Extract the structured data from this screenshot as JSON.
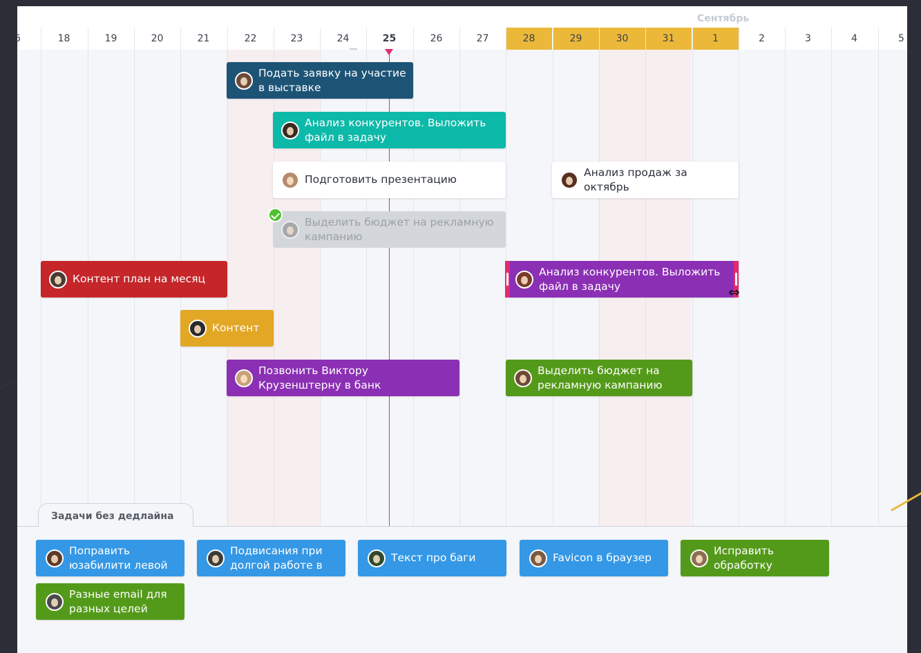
{
  "timeline": {
    "month_label": "Сентябрь",
    "today_day": "25",
    "days": [
      "6",
      "18",
      "19",
      "20",
      "21",
      "22",
      "23",
      "24",
      "25",
      "26",
      "27",
      "28",
      "29",
      "30",
      "31",
      "1",
      "2",
      "3",
      "4",
      "5"
    ]
  },
  "tasks": [
    {
      "name": "task-submit-exhibition",
      "title": "Подать заявку на участие в выставке",
      "color": "#1d5476",
      "style": "normal"
    },
    {
      "name": "task-competitor-analysis-1",
      "title": "Анализ конкурентов. Выложить файл в задачу",
      "color": "#0db9a9",
      "style": "normal"
    },
    {
      "name": "task-prepare-presentation",
      "title": "Подготовить презентацию",
      "color": "#ffffff",
      "style": "white"
    },
    {
      "name": "task-sales-analysis",
      "title": "Анализ продаж за октябрь",
      "color": "#ffffff",
      "style": "white"
    },
    {
      "name": "task-allocate-budget-done",
      "title": "Выделить бюджет на рекламную кампанию",
      "color": "#d3d6da",
      "style": "done"
    },
    {
      "name": "task-content-plan",
      "title": "Контент план на месяц",
      "color": "#c5262a",
      "style": "normal"
    },
    {
      "name": "task-competitor-analysis-2",
      "title": "Анализ конкурентов. Выложить файл в задачу",
      "color": "#8b2fb4",
      "style": "selected"
    },
    {
      "name": "task-content",
      "title": "Контент",
      "color": "#e2a725",
      "style": "normal"
    },
    {
      "name": "task-call-victor",
      "title": "Позвонить Виктору Крузенштерну в банк",
      "color": "#8b2fb4",
      "style": "normal"
    },
    {
      "name": "task-allocate-budget",
      "title": "Выделить бюджет на рекламную кампанию",
      "color": "#549a1a",
      "style": "normal"
    }
  ],
  "backlog": {
    "tab_label": "Задачи без дедлайна",
    "cards": [
      {
        "name": "backlog-card-usability",
        "title": "Поправить юзабилити левой",
        "color": "blue"
      },
      {
        "name": "backlog-card-hangs",
        "title": "Подвисания при долгой работе в",
        "color": "blue"
      },
      {
        "name": "backlog-card-bugs-text",
        "title": "Текст про баги",
        "color": "blue"
      },
      {
        "name": "backlog-card-favicon",
        "title": "Favicon в браузер",
        "color": "blue"
      },
      {
        "name": "backlog-card-fix-processing",
        "title": "Исправить обработку",
        "color": "green"
      },
      {
        "name": "backlog-card-emails",
        "title": "Разные email для разных целей",
        "color": "green"
      }
    ]
  },
  "avatar_colors": [
    "#6b4b3a",
    "#3a2a22",
    "#b58a6e",
    "#5a2e22",
    "#8a8a8a",
    "#4a3c34",
    "#7a3b2a",
    "#2a2a2a",
    "#c9a07a",
    "#6e4a36",
    "#5c3a2a",
    "#3c3c3c",
    "#7b5a44",
    "#2f4a2c",
    "#8c6e50",
    "#4a4a4a"
  ]
}
